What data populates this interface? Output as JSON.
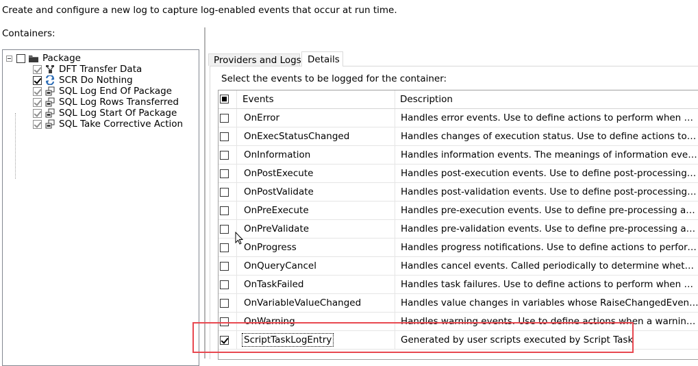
{
  "instructions": "Create and configure a new log to capture log-enabled events that occur at run time.",
  "containers_label": "Containers:",
  "tree": {
    "root": {
      "label": "Package",
      "checked": false
    },
    "children": [
      {
        "label": "DFT Transfer Data",
        "checked": true,
        "grey": true,
        "icon": "data-flow-icon"
      },
      {
        "label": "SCR Do Nothing",
        "checked": true,
        "grey": false,
        "icon": "script-task-icon"
      },
      {
        "label": "SQL Log End Of Package",
        "checked": true,
        "grey": true,
        "icon": "sql-task-icon"
      },
      {
        "label": "SQL Log Rows Transferred",
        "checked": true,
        "grey": true,
        "icon": "sql-task-icon"
      },
      {
        "label": "SQL Log Start Of Package",
        "checked": true,
        "grey": true,
        "icon": "sql-task-icon"
      },
      {
        "label": "SQL Take Corrective Action",
        "checked": true,
        "grey": true,
        "icon": "sql-task-icon"
      }
    ]
  },
  "tabs": [
    {
      "label": "Providers and Logs",
      "active": false
    },
    {
      "label": "Details",
      "active": true
    }
  ],
  "grid": {
    "label": "Select the events to be logged for the container:",
    "headers": {
      "events": "Events",
      "description": "Description"
    },
    "rows": [
      {
        "event": "OnError",
        "description": "Handles error events. Use to define actions to perform when an error occurs.",
        "checked": false
      },
      {
        "event": "OnExecStatusChanged",
        "description": "Handles changes of execution status. Use to define actions to perform when the execution status changes.",
        "checked": false
      },
      {
        "event": "OnInformation",
        "description": "Handles information events. The meanings of information events are task-defined.",
        "checked": false
      },
      {
        "event": "OnPostExecute",
        "description": "Handles post-execution events. Use to define post-processing actions.",
        "checked": false
      },
      {
        "event": "OnPostValidate",
        "description": "Handles post-validation events. Use to define post-processing actions.",
        "checked": false
      },
      {
        "event": "OnPreExecute",
        "description": "Handles pre-execution events. Use to define pre-processing actions.",
        "checked": false
      },
      {
        "event": "OnPreValidate",
        "description": "Handles pre-validation events. Use to define pre-processing actions.",
        "checked": false
      },
      {
        "event": "OnProgress",
        "description": "Handles progress notifications. Use to define actions to perform at progress intervals.",
        "checked": false
      },
      {
        "event": "OnQueryCancel",
        "description": "Handles cancel events. Called periodically to determine whether to cancel.",
        "checked": false
      },
      {
        "event": "OnTaskFailed",
        "description": "Handles task failures. Use to define actions to perform when a task fails.",
        "checked": false
      },
      {
        "event": "OnVariableValueChanged",
        "description": "Handles value changes in variables whose RaiseChangedEvent property is True.",
        "checked": false
      },
      {
        "event": "OnWarning",
        "description": "Handles warning events. Use to define actions when a warning occurs.",
        "checked": false
      },
      {
        "event": "ScriptTaskLogEntry",
        "description": "Generated by user scripts executed by Script Task",
        "checked": true
      }
    ]
  },
  "colors": {
    "highlight": "#e8474f",
    "border": "#a0a0a0"
  }
}
